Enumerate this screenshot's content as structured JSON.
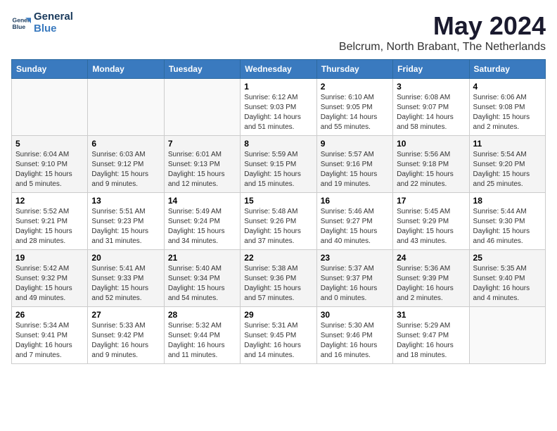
{
  "header": {
    "logo_line1": "General",
    "logo_line2": "Blue",
    "title": "May 2024",
    "subtitle": "Belcrum, North Brabant, The Netherlands"
  },
  "days_of_week": [
    "Sunday",
    "Monday",
    "Tuesday",
    "Wednesday",
    "Thursday",
    "Friday",
    "Saturday"
  ],
  "weeks": [
    [
      {
        "day": "",
        "sunrise": "",
        "sunset": "",
        "daylight": ""
      },
      {
        "day": "",
        "sunrise": "",
        "sunset": "",
        "daylight": ""
      },
      {
        "day": "",
        "sunrise": "",
        "sunset": "",
        "daylight": ""
      },
      {
        "day": "1",
        "sunrise": "Sunrise: 6:12 AM",
        "sunset": "Sunset: 9:03 PM",
        "daylight": "Daylight: 14 hours and 51 minutes."
      },
      {
        "day": "2",
        "sunrise": "Sunrise: 6:10 AM",
        "sunset": "Sunset: 9:05 PM",
        "daylight": "Daylight: 14 hours and 55 minutes."
      },
      {
        "day": "3",
        "sunrise": "Sunrise: 6:08 AM",
        "sunset": "Sunset: 9:07 PM",
        "daylight": "Daylight: 14 hours and 58 minutes."
      },
      {
        "day": "4",
        "sunrise": "Sunrise: 6:06 AM",
        "sunset": "Sunset: 9:08 PM",
        "daylight": "Daylight: 15 hours and 2 minutes."
      }
    ],
    [
      {
        "day": "5",
        "sunrise": "Sunrise: 6:04 AM",
        "sunset": "Sunset: 9:10 PM",
        "daylight": "Daylight: 15 hours and 5 minutes."
      },
      {
        "day": "6",
        "sunrise": "Sunrise: 6:03 AM",
        "sunset": "Sunset: 9:12 PM",
        "daylight": "Daylight: 15 hours and 9 minutes."
      },
      {
        "day": "7",
        "sunrise": "Sunrise: 6:01 AM",
        "sunset": "Sunset: 9:13 PM",
        "daylight": "Daylight: 15 hours and 12 minutes."
      },
      {
        "day": "8",
        "sunrise": "Sunrise: 5:59 AM",
        "sunset": "Sunset: 9:15 PM",
        "daylight": "Daylight: 15 hours and 15 minutes."
      },
      {
        "day": "9",
        "sunrise": "Sunrise: 5:57 AM",
        "sunset": "Sunset: 9:16 PM",
        "daylight": "Daylight: 15 hours and 19 minutes."
      },
      {
        "day": "10",
        "sunrise": "Sunrise: 5:56 AM",
        "sunset": "Sunset: 9:18 PM",
        "daylight": "Daylight: 15 hours and 22 minutes."
      },
      {
        "day": "11",
        "sunrise": "Sunrise: 5:54 AM",
        "sunset": "Sunset: 9:20 PM",
        "daylight": "Daylight: 15 hours and 25 minutes."
      }
    ],
    [
      {
        "day": "12",
        "sunrise": "Sunrise: 5:52 AM",
        "sunset": "Sunset: 9:21 PM",
        "daylight": "Daylight: 15 hours and 28 minutes."
      },
      {
        "day": "13",
        "sunrise": "Sunrise: 5:51 AM",
        "sunset": "Sunset: 9:23 PM",
        "daylight": "Daylight: 15 hours and 31 minutes."
      },
      {
        "day": "14",
        "sunrise": "Sunrise: 5:49 AM",
        "sunset": "Sunset: 9:24 PM",
        "daylight": "Daylight: 15 hours and 34 minutes."
      },
      {
        "day": "15",
        "sunrise": "Sunrise: 5:48 AM",
        "sunset": "Sunset: 9:26 PM",
        "daylight": "Daylight: 15 hours and 37 minutes."
      },
      {
        "day": "16",
        "sunrise": "Sunrise: 5:46 AM",
        "sunset": "Sunset: 9:27 PM",
        "daylight": "Daylight: 15 hours and 40 minutes."
      },
      {
        "day": "17",
        "sunrise": "Sunrise: 5:45 AM",
        "sunset": "Sunset: 9:29 PM",
        "daylight": "Daylight: 15 hours and 43 minutes."
      },
      {
        "day": "18",
        "sunrise": "Sunrise: 5:44 AM",
        "sunset": "Sunset: 9:30 PM",
        "daylight": "Daylight: 15 hours and 46 minutes."
      }
    ],
    [
      {
        "day": "19",
        "sunrise": "Sunrise: 5:42 AM",
        "sunset": "Sunset: 9:32 PM",
        "daylight": "Daylight: 15 hours and 49 minutes."
      },
      {
        "day": "20",
        "sunrise": "Sunrise: 5:41 AM",
        "sunset": "Sunset: 9:33 PM",
        "daylight": "Daylight: 15 hours and 52 minutes."
      },
      {
        "day": "21",
        "sunrise": "Sunrise: 5:40 AM",
        "sunset": "Sunset: 9:34 PM",
        "daylight": "Daylight: 15 hours and 54 minutes."
      },
      {
        "day": "22",
        "sunrise": "Sunrise: 5:38 AM",
        "sunset": "Sunset: 9:36 PM",
        "daylight": "Daylight: 15 hours and 57 minutes."
      },
      {
        "day": "23",
        "sunrise": "Sunrise: 5:37 AM",
        "sunset": "Sunset: 9:37 PM",
        "daylight": "Daylight: 16 hours and 0 minutes."
      },
      {
        "day": "24",
        "sunrise": "Sunrise: 5:36 AM",
        "sunset": "Sunset: 9:39 PM",
        "daylight": "Daylight: 16 hours and 2 minutes."
      },
      {
        "day": "25",
        "sunrise": "Sunrise: 5:35 AM",
        "sunset": "Sunset: 9:40 PM",
        "daylight": "Daylight: 16 hours and 4 minutes."
      }
    ],
    [
      {
        "day": "26",
        "sunrise": "Sunrise: 5:34 AM",
        "sunset": "Sunset: 9:41 PM",
        "daylight": "Daylight: 16 hours and 7 minutes."
      },
      {
        "day": "27",
        "sunrise": "Sunrise: 5:33 AM",
        "sunset": "Sunset: 9:42 PM",
        "daylight": "Daylight: 16 hours and 9 minutes."
      },
      {
        "day": "28",
        "sunrise": "Sunrise: 5:32 AM",
        "sunset": "Sunset: 9:44 PM",
        "daylight": "Daylight: 16 hours and 11 minutes."
      },
      {
        "day": "29",
        "sunrise": "Sunrise: 5:31 AM",
        "sunset": "Sunset: 9:45 PM",
        "daylight": "Daylight: 16 hours and 14 minutes."
      },
      {
        "day": "30",
        "sunrise": "Sunrise: 5:30 AM",
        "sunset": "Sunset: 9:46 PM",
        "daylight": "Daylight: 16 hours and 16 minutes."
      },
      {
        "day": "31",
        "sunrise": "Sunrise: 5:29 AM",
        "sunset": "Sunset: 9:47 PM",
        "daylight": "Daylight: 16 hours and 18 minutes."
      },
      {
        "day": "",
        "sunrise": "",
        "sunset": "",
        "daylight": ""
      }
    ]
  ]
}
